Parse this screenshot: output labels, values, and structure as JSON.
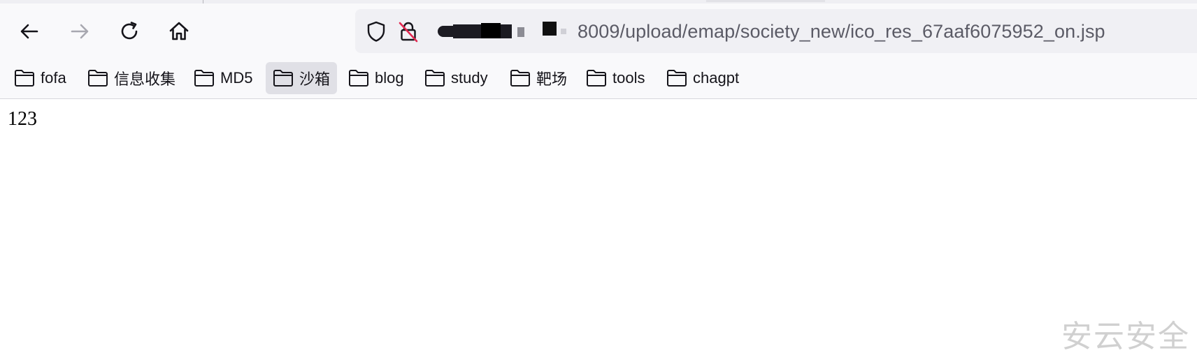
{
  "address_bar": {
    "url_visible": "8009/upload/emap/society_new/ico_res_67aaf6075952_on.jsp",
    "security_icon": "shield-icon",
    "lock_icon": "insecure-lock-icon"
  },
  "navigation": {
    "back_icon": "arrow-left-icon",
    "forward_icon": "arrow-right-icon",
    "reload_icon": "reload-icon",
    "home_icon": "home-icon"
  },
  "bookmarks": [
    {
      "label": "fofa"
    },
    {
      "label": "信息收集"
    },
    {
      "label": "MD5"
    },
    {
      "label": "沙箱",
      "active": true
    },
    {
      "label": "blog"
    },
    {
      "label": "study"
    },
    {
      "label": "靶场"
    },
    {
      "label": "tools"
    },
    {
      "label": "chagpt"
    }
  ],
  "page": {
    "body_text": "123"
  },
  "watermark": {
    "text": "安云安全"
  },
  "colors": {
    "chrome_bg": "#f9f9fb",
    "url_bar_bg": "#f0f0f4",
    "url_text": "#5b5b66",
    "icon": "#15141a",
    "icon_disabled": "#a8a8b0",
    "insecure_accent": "#e22850",
    "active_bookmark_bg": "#e0e0e6"
  }
}
